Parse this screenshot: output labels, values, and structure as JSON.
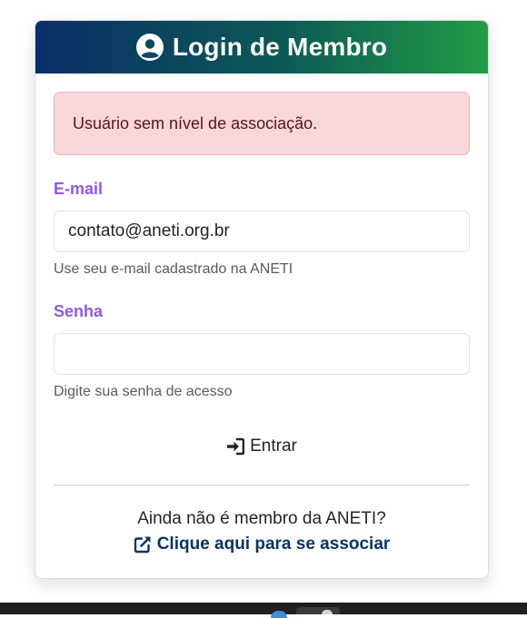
{
  "header": {
    "title": "Login de Membro",
    "icon": "user-circle-icon"
  },
  "alert": {
    "message": "Usuário sem nível de associação.",
    "color": "#f8d7da"
  },
  "email": {
    "label": "E-mail",
    "value": "contato@aneti.org.br",
    "help": "Use seu e-mail cadastrado na ANETI"
  },
  "password": {
    "label": "Senha",
    "value": "",
    "help": "Digite sua senha de acesso"
  },
  "submit": {
    "label": "Entrar",
    "icon": "sign-in-icon"
  },
  "footer": {
    "text": "Ainda não é membro da ANETI?",
    "link_label": "Clique aqui para se associar",
    "link_icon": "external-link-icon"
  },
  "colors": {
    "accent": "#8f57e8",
    "link": "#0b3463",
    "header_start": "#0a2e68",
    "header_end": "#229c45"
  }
}
